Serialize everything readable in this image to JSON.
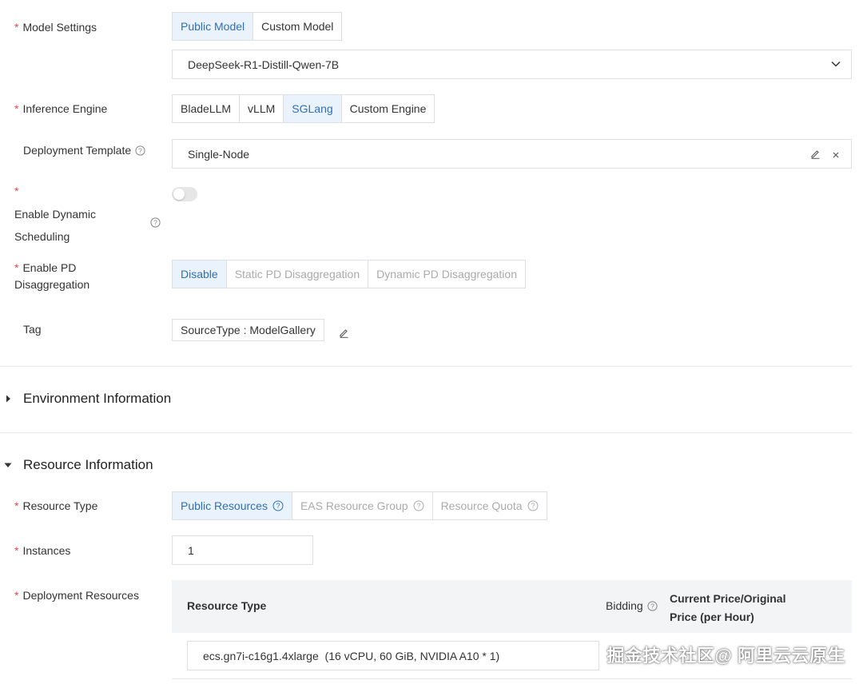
{
  "model_settings": {
    "label": "Model Settings",
    "tabs": [
      "Public Model",
      "Custom Model"
    ],
    "selected_model": "DeepSeek-R1-Distill-Qwen-7B"
  },
  "inference_engine": {
    "label": "Inference Engine",
    "options": [
      "BladeLLM",
      "vLLM",
      "SGLang",
      "Custom Engine"
    ]
  },
  "deployment_template": {
    "label": "Deployment Template",
    "value": "Single-Node"
  },
  "dynamic_scheduling": {
    "label_line1": "Enable Dynamic",
    "label_line2": "Scheduling",
    "enabled": false
  },
  "pd_disaggregation": {
    "label_line1": "Enable PD",
    "label_line2": "Disaggregation",
    "options": [
      "Disable",
      "Static PD Disaggregation",
      "Dynamic PD Disaggregation"
    ]
  },
  "tag": {
    "label": "Tag",
    "value": "SourceType : ModelGallery"
  },
  "environment_section": {
    "title": "Environment Information"
  },
  "resource_section": {
    "title": "Resource Information"
  },
  "resource_type": {
    "label": "Resource Type",
    "options": [
      "Public Resources",
      "EAS Resource Group",
      "Resource Quota"
    ]
  },
  "instances": {
    "label": "Instances",
    "value": "1"
  },
  "deployment_resources": {
    "label": "Deployment Resources",
    "columns": {
      "resource_type": "Resource Type",
      "bidding": "Bidding",
      "price_line1": "Current Price/Original",
      "price_line2": "Price (per Hour)"
    },
    "selected_instance": "ecs.gn7i-c16g1.4xlarge  (16 vCPU, 60 GiB, NVIDIA A10 * 1)"
  },
  "watermark": "掘金技术社区@ 阿里云云原生",
  "colors": {
    "accent": "#2f6fb8",
    "active_bg": "#eaf3fb",
    "required": "#e5484d",
    "border": "#dcdfe6"
  }
}
